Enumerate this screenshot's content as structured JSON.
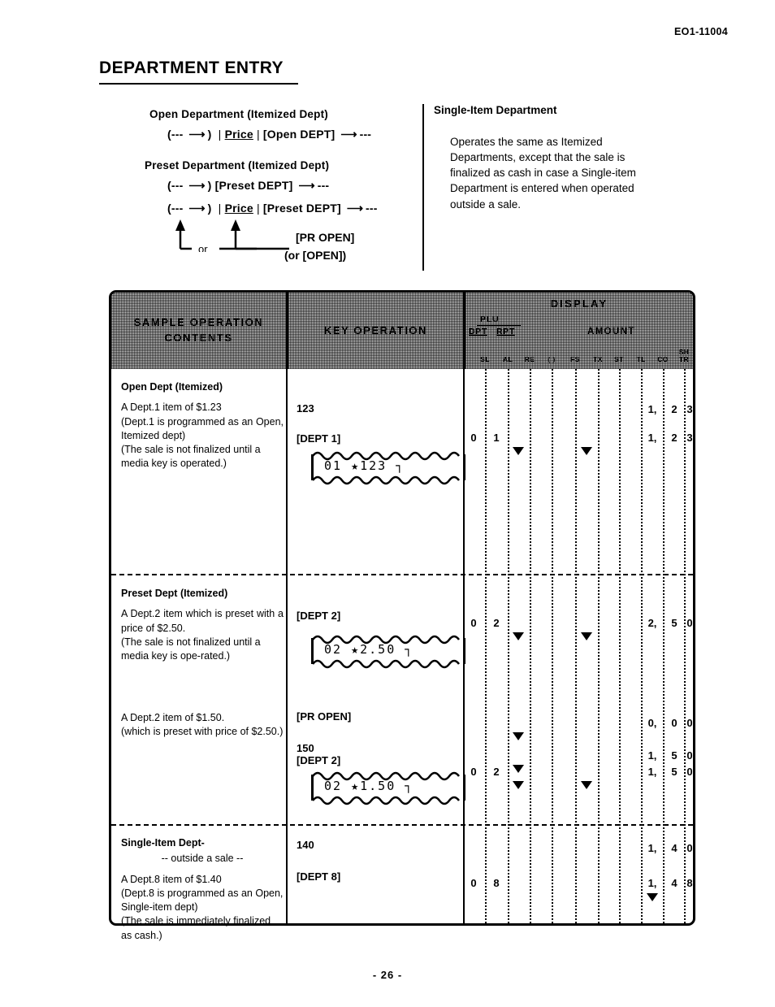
{
  "doc_code": "EO1-11004",
  "page_title": "DEPARTMENT ENTRY",
  "page_number": "- 26 -",
  "diagram": {
    "open_dept": {
      "heading": "Open Department (Itemized Dept)",
      "prefix": "(---",
      "paren_close": ")",
      "price_label": "Price",
      "key_label": "[Open DEPT]",
      "suffix": "---"
    },
    "preset_dept": {
      "heading": "Preset Department  (Itemized Dept)",
      "line1": {
        "prefix": "(---",
        "paren_close": ")",
        "key_label": "[Preset DEPT]",
        "suffix": "---"
      },
      "line2": {
        "prefix": "(---",
        "paren_close": ")",
        "price_label": "Price",
        "key_label": "[Preset DEPT]",
        "suffix": "---"
      },
      "or_label": "or",
      "pr_open_label": "[PR OPEN]",
      "or_open_label": "(or [OPEN])"
    },
    "single_item": {
      "heading": "Single-Item Department",
      "body": "Operates the same as Itemized Departments, except that the sale is finalized as cash in case a Single-item Department is entered when operated outside a sale."
    }
  },
  "table": {
    "headers": {
      "sample": "SAMPLE OPERATION CONTENTS",
      "key": "KEY OPERATION",
      "display": "DISPLAY",
      "plu": "PLU",
      "dpt": "DPT",
      "rpt": "RPT",
      "amount": "AMOUNT",
      "flags": [
        "SL",
        "AL",
        "RE",
        "( )",
        "FS",
        "TX",
        "ST",
        "TL",
        "CO",
        "SH/TR"
      ]
    },
    "rows": [
      {
        "title": "Open Dept  (Itemized)",
        "description": [
          "A Dept.1 item of $1.23",
          "(Dept.1 is programmed as an Open, Itemized dept)",
          "(The sale is not finalized until a media key is operated.)"
        ],
        "keys": [
          {
            "label": "123"
          },
          {
            "label": "[DEPT 1]"
          }
        ],
        "receipt": "01    ★123  ┐",
        "display": [
          {
            "dpt": "",
            "rpt": "",
            "amount": "1,23",
            "markers": []
          },
          {
            "dpt": "0",
            "rpt": "1",
            "amount": "1,23",
            "markers": [
              "RE",
              "ST"
            ]
          }
        ]
      },
      {
        "title": "Preset Dept  (Itemized)",
        "description": [
          "A Dept.2 item which is preset with a price of $2.50.",
          "(The sale is not finalized until a media key is ope-rated.)"
        ],
        "description2": [
          "A Dept.2 item of $1.50.",
          "(which is preset with price of $2.50.)"
        ],
        "keys": [
          {
            "label": "[DEPT 2]"
          }
        ],
        "receipt": "02    ★2.50  ┐",
        "keys2": [
          {
            "label": "[PR OPEN]"
          },
          {
            "label": "150"
          },
          {
            "label": "[DEPT 2]"
          }
        ],
        "receipt2": "02    ★1.50  ┐",
        "display": [
          {
            "dpt": "0",
            "rpt": "2",
            "amount": "2,50",
            "markers": [
              "RE",
              "ST"
            ]
          },
          {
            "dpt": "",
            "rpt": "",
            "amount": "0,00",
            "markers": [
              "RE"
            ]
          },
          {
            "dpt": "",
            "rpt": "",
            "amount": "1,50",
            "markers": [
              "RE"
            ]
          },
          {
            "dpt": "0",
            "rpt": "2",
            "amount": "1,50",
            "markers": [
              "RE",
              "ST"
            ]
          }
        ]
      },
      {
        "title": "Single-Item Dept-",
        "subtitle": "-- outside a sale  --",
        "description": [
          "A Dept.8 item of $1.40",
          "(Dept.8 is programmed as an Open, Single-item dept)",
          "(The sale is  immediately finalized as  cash.)"
        ],
        "keys": [
          {
            "label": "140"
          },
          {
            "label": "[DEPT 8]"
          }
        ],
        "display": [
          {
            "dpt": "",
            "rpt": "",
            "amount": "1,40",
            "markers": []
          },
          {
            "dpt": "0",
            "rpt": "8",
            "amount": "1,48",
            "markers": [
              "TL"
            ]
          }
        ]
      }
    ]
  }
}
